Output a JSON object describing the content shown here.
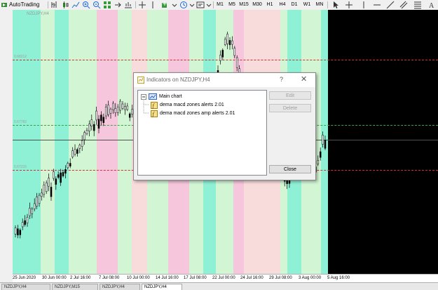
{
  "toolbar": {
    "autotrading_label": "AutoTrading",
    "timeframes": [
      "M1",
      "M5",
      "M15",
      "M30",
      "H1",
      "H4",
      "D1",
      "W1",
      "MN"
    ]
  },
  "chart": {
    "symbol_caption": "NZDJPY,H4",
    "background": "#000000",
    "zone_colors": {
      "mint": "#8ef0d4",
      "light_green": "#d2f6d4",
      "pink": "#f6c6dc",
      "light_pink": "#f8dcdc"
    },
    "levels": {
      "upper": "0.68212",
      "middle": "0.67782",
      "lower": "0.67215"
    },
    "date_labels": [
      "25 Jun 2020",
      "30 Jun 00:00",
      "2 Jul 16:00",
      "7 Jul 08:00",
      "10 Jul 00:00",
      "14 Jul 16:00",
      "17 Jul 08:00",
      "22 Jul 00:00",
      "24 Jul 16:00",
      "29 Jul 08:00",
      "3 Aug 00:00",
      "5 Aug 16:00"
    ]
  },
  "tabs": [
    "NZDJPY,H4",
    "NZDJPY,M15",
    "NZDJPY,H4",
    "NZDJPY,H4"
  ],
  "dialog": {
    "title": "Indicators on NZDJPY,H4",
    "help": "?",
    "close_glyph": "✕",
    "tree": {
      "root": "Main chart",
      "items": [
        "dema macd zones alerts 2.01",
        "dema macd zones amp alerts 2.01"
      ]
    },
    "buttons": {
      "edit": "Edit",
      "delete": "Delete",
      "close": "Close"
    }
  }
}
